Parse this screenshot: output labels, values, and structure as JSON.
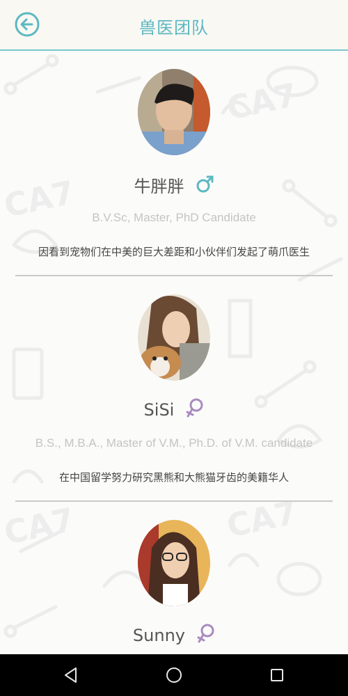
{
  "header": {
    "title": "兽医团队",
    "back_icon": "back-arrow-circle-icon"
  },
  "colors": {
    "accent": "#5bb8c2",
    "divider": "#c9c9c9",
    "male": "#5bb8c2",
    "female": "#a98bbf"
  },
  "vets": [
    {
      "name": "牛胖胖",
      "gender": "male",
      "gender_icon": "male-symbol-icon",
      "degree": "B.V.Sc, Master, PhD Candidate",
      "bio": "因看到宠物们在中美的巨大差距和小伙伴们发起了萌爪医生"
    },
    {
      "name": "SiSi",
      "gender": "female",
      "gender_icon": "female-symbol-icon",
      "degree": "B.S., M.B.A., Master of V.M., Ph.D. of V.M. candidate",
      "bio": "在中国留学努力研究黑熊和大熊猫牙齿的美籍华人"
    },
    {
      "name": "Sunny",
      "gender": "female",
      "gender_icon": "female-symbol-icon",
      "degree": "",
      "bio": ""
    }
  ],
  "navbar": {
    "back_icon": "nav-back-triangle-icon",
    "home_icon": "nav-home-circle-icon",
    "recents_icon": "nav-recents-square-icon"
  }
}
